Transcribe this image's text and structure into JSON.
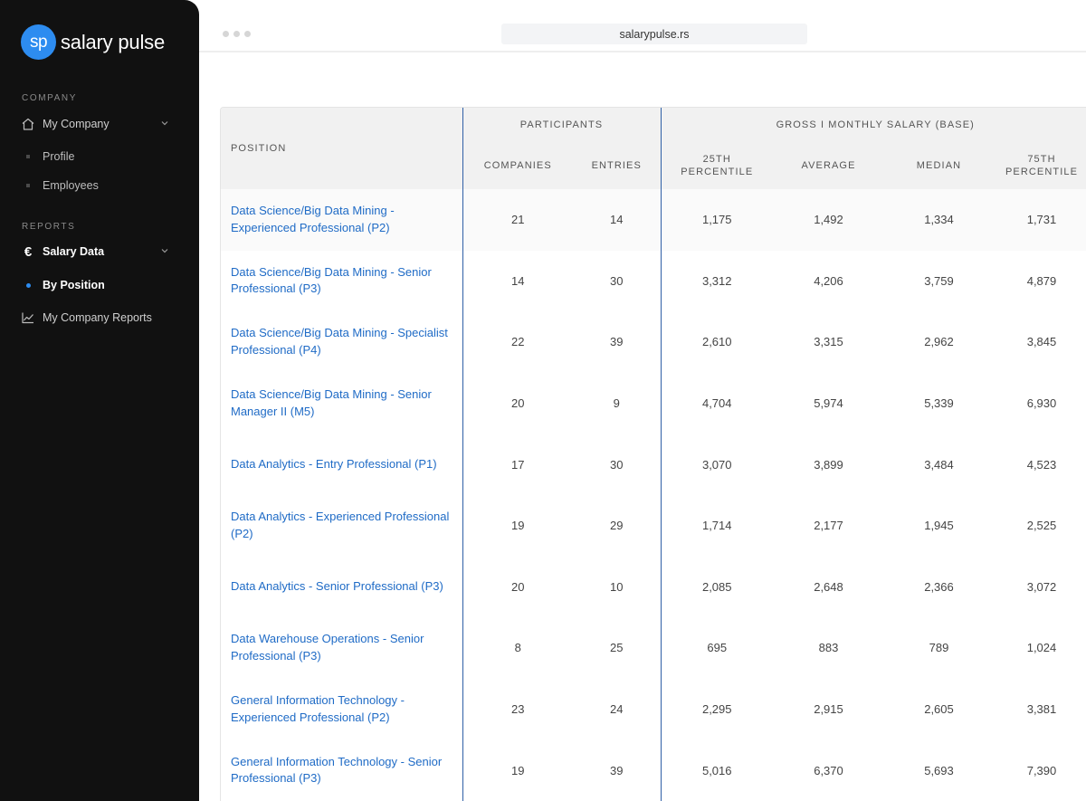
{
  "brand": {
    "logo_text": "sp",
    "name": "salary pulse",
    "accent_color": "#2d8cf0"
  },
  "sidebar": {
    "company_label": "COMPANY",
    "my_company": {
      "label": "My Company",
      "icon": "home-icon",
      "chevron": "chevron-down-icon"
    },
    "company_items": [
      {
        "label": "Profile"
      },
      {
        "label": "Employees"
      }
    ],
    "reports_label": "REPORTS",
    "salary_data": {
      "label": "Salary Data",
      "icon": "euro-icon",
      "chevron": "chevron-down-icon"
    },
    "by_position": {
      "label": "By Position",
      "active": true
    },
    "company_reports": {
      "label": "My Company Reports",
      "icon": "line-chart-icon"
    }
  },
  "browser": {
    "url": "salarypulse.rs"
  },
  "table": {
    "headers": {
      "position": "POSITION",
      "participants": "PARTICIPANTS",
      "companies": "COMPANIES",
      "entries": "ENTRIES",
      "salary_group": "GROSS I MONTHLY SALARY (BASE)",
      "p25_line1": "25TH",
      "p25_line2": "PERCENTILE",
      "average": "AVERAGE",
      "median": "MEDIAN",
      "p75_line1": "75TH",
      "p75_line2": "PERCENTILE"
    },
    "rows": [
      {
        "position": "Data Science/Big Data Mining - Experienced Professional (P2)",
        "companies": "21",
        "entries": "14",
        "p25": "1,175",
        "average": "1,492",
        "median": "1,334",
        "p75": "1,731"
      },
      {
        "position": "Data Science/Big Data Mining - Senior Professional (P3)",
        "companies": "14",
        "entries": "30",
        "p25": "3,312",
        "average": "4,206",
        "median": "3,759",
        "p75": "4,879"
      },
      {
        "position": "Data Science/Big Data Mining - Specialist Professional (P4)",
        "companies": "22",
        "entries": "39",
        "p25": "2,610",
        "average": "3,315",
        "median": "2,962",
        "p75": "3,845"
      },
      {
        "position": "Data Science/Big Data Mining - Senior Manager II (M5)",
        "companies": "20",
        "entries": "9",
        "p25": "4,704",
        "average": "5,974",
        "median": "5,339",
        "p75": "6,930"
      },
      {
        "position": "Data Analytics - Entry Professional (P1)",
        "companies": "17",
        "entries": "30",
        "p25": "3,070",
        "average": "3,899",
        "median": "3,484",
        "p75": "4,523"
      },
      {
        "position": "Data Analytics - Experienced Professional (P2)",
        "companies": "19",
        "entries": "29",
        "p25": "1,714",
        "average": "2,177",
        "median": "1,945",
        "p75": "2,525"
      },
      {
        "position": "Data Analytics - Senior Professional (P3)",
        "companies": "20",
        "entries": "10",
        "p25": "2,085",
        "average": "2,648",
        "median": "2,366",
        "p75": "3,072"
      },
      {
        "position": "Data Warehouse Operations - Senior Professional (P3)",
        "companies": "8",
        "entries": "25",
        "p25": "695",
        "average": "883",
        "median": "789",
        "p75": "1,024"
      },
      {
        "position": "General Information Technology - Experienced Professional (P2)",
        "companies": "23",
        "entries": "24",
        "p25": "2,295",
        "average": "2,915",
        "median": "2,605",
        "p75": "3,381"
      },
      {
        "position": "General Information Technology - Senior Professional (P3)",
        "companies": "19",
        "entries": "39",
        "p25": "5,016",
        "average": "6,370",
        "median": "5,693",
        "p75": "7,390"
      }
    ]
  }
}
